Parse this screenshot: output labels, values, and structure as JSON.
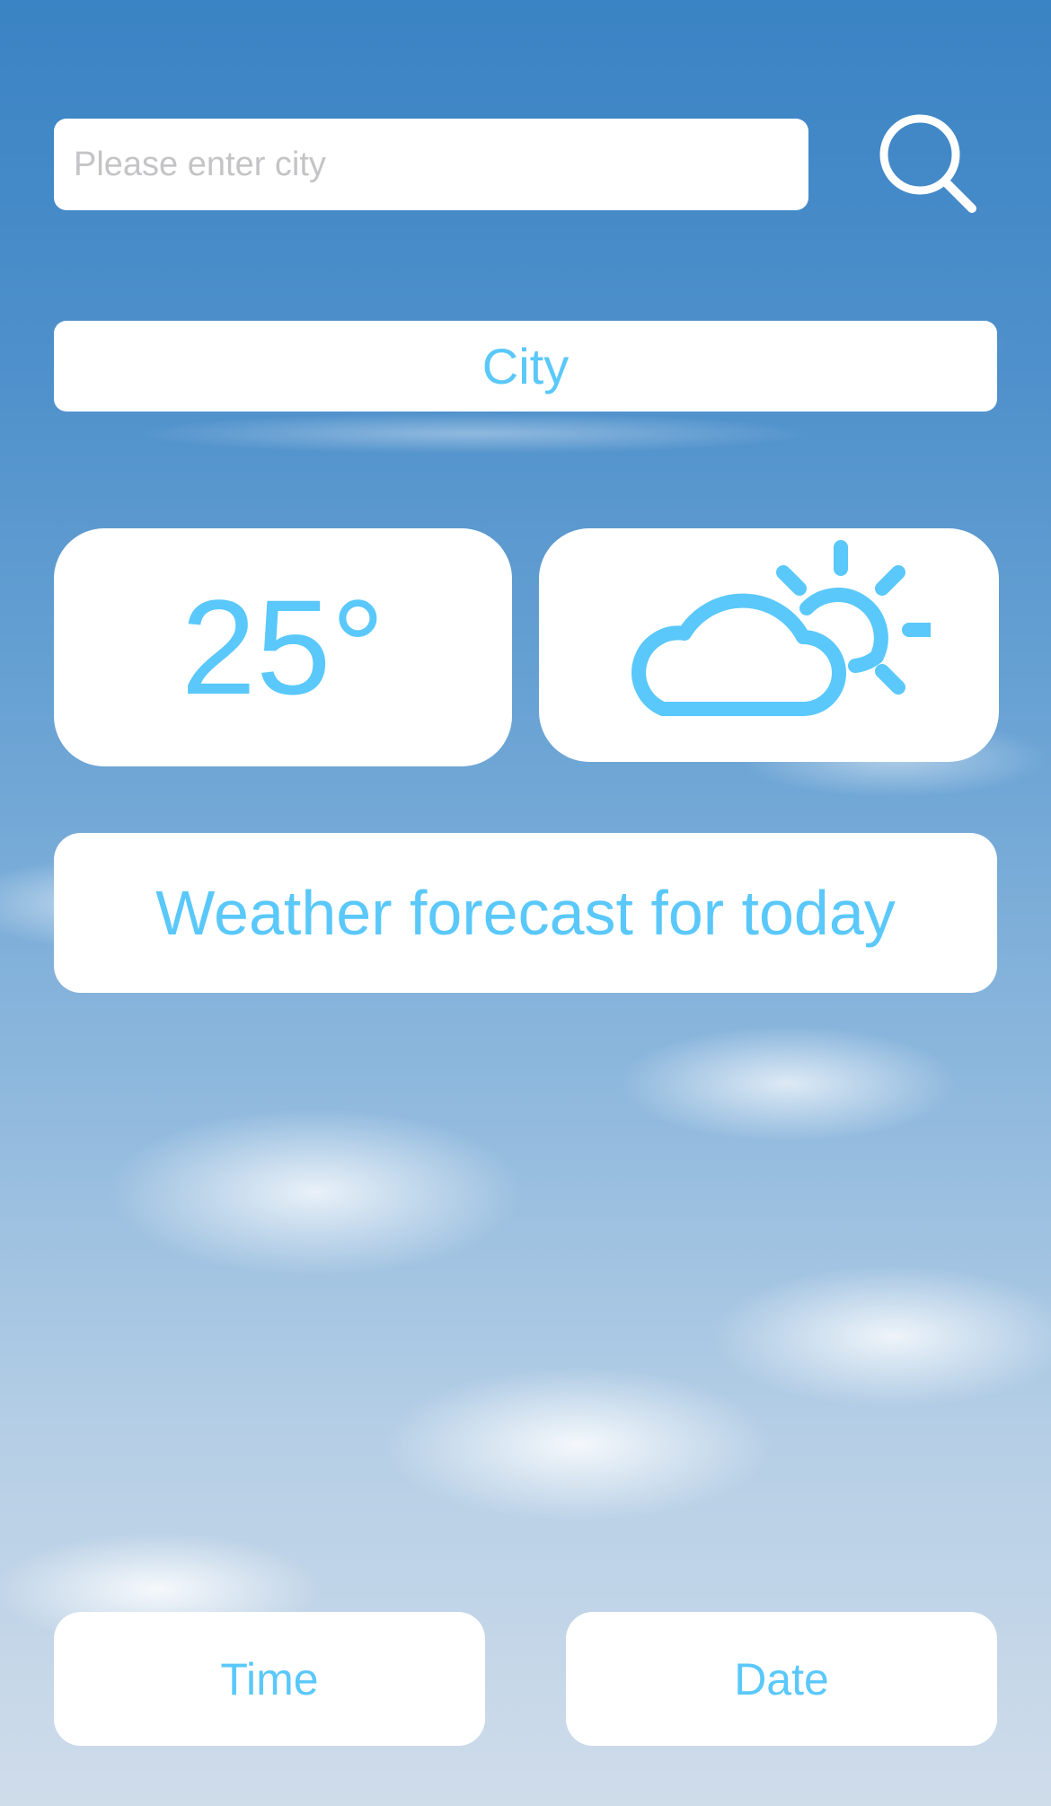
{
  "search": {
    "placeholder": "Please enter city",
    "value": ""
  },
  "city": {
    "label": "City"
  },
  "weather": {
    "temperature": "25°",
    "condition_icon": "partly-cloudy-icon",
    "forecast_label": "Weather forecast for today"
  },
  "buttons": {
    "time_label": "Time",
    "date_label": "Date"
  },
  "colors": {
    "accent": "#5ac8fa",
    "panel": "#ffffff",
    "sky": "#3a83c4"
  }
}
